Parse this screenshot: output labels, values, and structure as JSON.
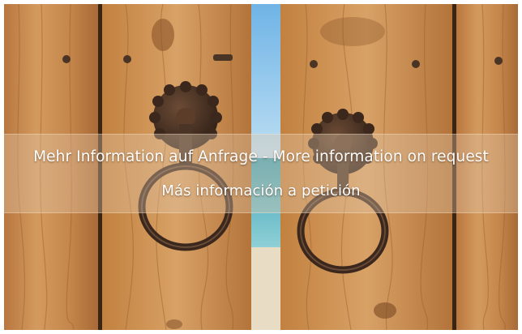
{
  "photo": {
    "subject": "wooden-door-with-ring-knockers-and-sea-view",
    "colors": {
      "wood": "#c98b50",
      "wood_dark": "#8a5428",
      "gap_dark": "#3a2412",
      "sky": "#8fc6e8",
      "sea": "#3f9fb4",
      "sand": "#e8dcc6",
      "iron": "#4a3426"
    }
  },
  "overlay": {
    "line1": "Mehr Information auf Anfrage - More information on request",
    "line2": "Más información a petición"
  }
}
